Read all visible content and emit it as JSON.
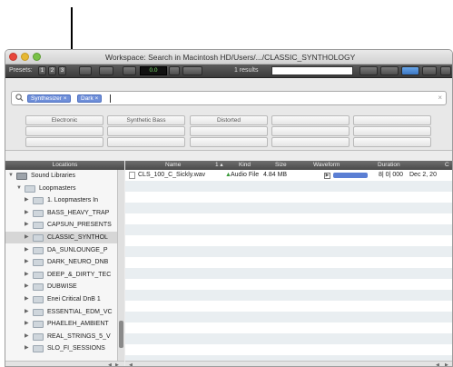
{
  "window": {
    "title": "Workspace: Search in Macintosh HD/Users/.../CLASSIC_SYNTHOLOGY"
  },
  "toolbar": {
    "presets_label": "Presets:",
    "preset_buttons": [
      "1",
      "2",
      "3"
    ],
    "display_value": "0.0",
    "results_label": "1 results"
  },
  "search": {
    "tokens": [
      "Synthesizer ×",
      "Dark ×"
    ],
    "clear_glyph": "×",
    "tags": [
      [
        "Electronic",
        "Synthetic Bass",
        "Distorted",
        "",
        ""
      ],
      [
        "",
        "",
        "",
        "",
        ""
      ],
      [
        "",
        "",
        "",
        "",
        ""
      ]
    ]
  },
  "locations": {
    "header": "Locations",
    "items": [
      {
        "label": "Sound Libraries",
        "depth": 0,
        "expanded": true,
        "type": "drive"
      },
      {
        "label": "Loopmasters",
        "depth": 1,
        "expanded": true,
        "type": "folder"
      },
      {
        "label": "1. Loopmasters In",
        "depth": 2,
        "expanded": false,
        "type": "folder"
      },
      {
        "label": "BASS_HEAVY_TRAP",
        "depth": 2,
        "expanded": false,
        "type": "folder"
      },
      {
        "label": "CAPSUN_PRESENTS",
        "depth": 2,
        "expanded": false,
        "type": "folder"
      },
      {
        "label": "CLASSIC_SYNTHOL",
        "depth": 2,
        "expanded": false,
        "type": "folder",
        "selected": true
      },
      {
        "label": "DA_SUNLOUNGE_P",
        "depth": 2,
        "expanded": false,
        "type": "folder"
      },
      {
        "label": "DARK_NEURO_DNB",
        "depth": 2,
        "expanded": false,
        "type": "folder"
      },
      {
        "label": "DEEP_&_DIRTY_TEC",
        "depth": 2,
        "expanded": false,
        "type": "folder"
      },
      {
        "label": "DUBWISE",
        "depth": 2,
        "expanded": false,
        "type": "folder"
      },
      {
        "label": "Enei Critical DnB 1",
        "depth": 2,
        "expanded": false,
        "type": "folder"
      },
      {
        "label": "ESSENTIAL_EDM_VC",
        "depth": 2,
        "expanded": false,
        "type": "folder"
      },
      {
        "label": "PHAELEH_AMBIENT",
        "depth": 2,
        "expanded": false,
        "type": "folder"
      },
      {
        "label": "REAL_STRINGS_5_V",
        "depth": 2,
        "expanded": false,
        "type": "folder"
      },
      {
        "label": "SLO_FI_SESSIONS",
        "depth": 2,
        "expanded": false,
        "type": "folder"
      }
    ]
  },
  "results": {
    "columns": [
      "Name",
      "1 ▴",
      "Kind",
      "Size",
      "Waveform",
      "Duration",
      "C"
    ],
    "rows": [
      {
        "name": "CLS_100_C_Sickly.wav",
        "kind": "Audio File",
        "size": "4.84 MB",
        "duration": "8| 0| 000",
        "created": "Dec 2, 20"
      }
    ]
  },
  "colors": {
    "token_blue": "#6f8fd9",
    "selected_row": "#d6d6d6",
    "stripe": "#e9eef1",
    "waveform": "#5b7fd4"
  }
}
